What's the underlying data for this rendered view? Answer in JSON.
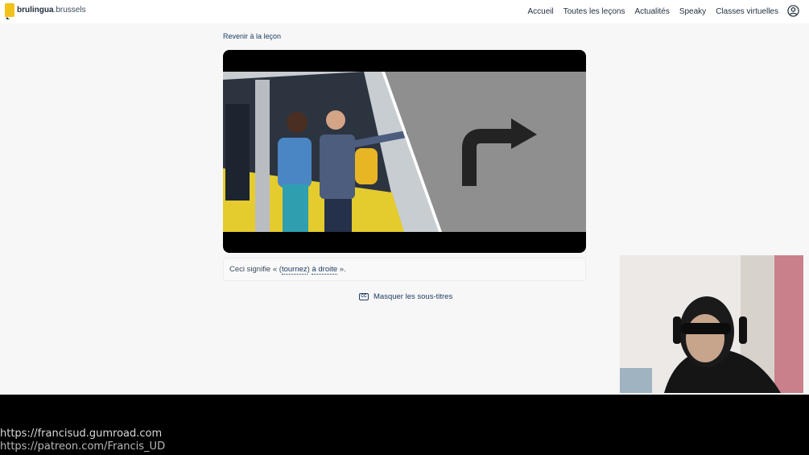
{
  "header": {
    "logo_brand": "brulingua",
    "logo_domain": ".brussels",
    "nav": [
      {
        "label": "Accueil"
      },
      {
        "label": "Toutes les leçons"
      },
      {
        "label": "Actualités"
      },
      {
        "label": "Speaky"
      },
      {
        "label": "Classes virtuelles"
      }
    ]
  },
  "lesson": {
    "back_label": "Revenir à la leçon",
    "caption": {
      "prefix": "Ceci signifie « (",
      "word1": "tournez",
      "mid": ") ",
      "word2": "à droite",
      "suffix": " »."
    },
    "subtitles_toggle_label": "Masquer les sous-titres"
  },
  "icons": {
    "user": "user-circle-icon",
    "cc": "closed-captions-icon",
    "arrow": "turn-right-arrow-icon"
  },
  "footer": {
    "link1": "https://francisud.gumroad.com",
    "link2": "https://patreon.com/Francis_UD"
  },
  "colors": {
    "accent": "#1f3c63",
    "logo_yellow": "#f2c21b",
    "video_bg": "#000000",
    "graphic_bg": "#8f8f8f"
  }
}
